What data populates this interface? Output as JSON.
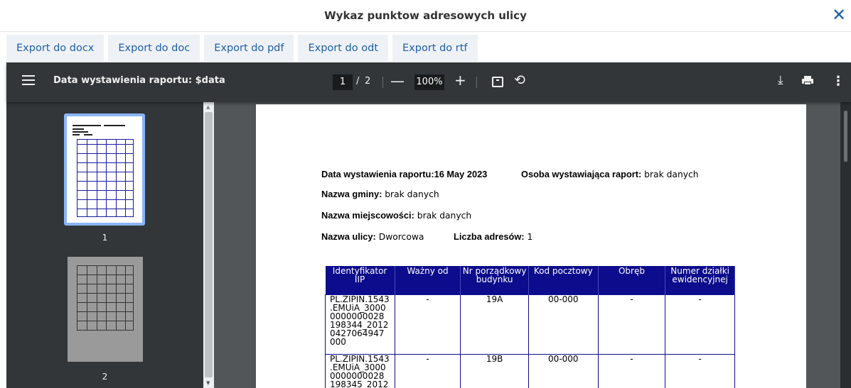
{
  "dialog": {
    "title": "Wykaz punktow adresowych ulicy",
    "close_icon": "close-icon"
  },
  "export_buttons": [
    {
      "label": "Export do docx"
    },
    {
      "label": "Export do doc"
    },
    {
      "label": "Export do pdf"
    },
    {
      "label": "Export do odt"
    },
    {
      "label": "Export do rtf"
    }
  ],
  "pdf_toolbar": {
    "title": "Data wystawienia raportu: $data",
    "current_page": "1",
    "page_separator": "/",
    "total_pages": "2",
    "zoom": "100%",
    "zoom_out_symbol": "—",
    "zoom_in_symbol": "+"
  },
  "thumbnails": [
    {
      "label": "1",
      "selected": true
    },
    {
      "label": "2",
      "selected": false
    }
  ],
  "report": {
    "date_label": "Data wystawienia raportu:",
    "date_value": "16 May 2023",
    "issuer_label": "Osoba wystawiająca raport:",
    "issuer_value": " brak danych",
    "municipality_label": "Nazwa gminy:",
    "municipality_value": " brak danych",
    "locality_label": "Nazwa miejscowości:",
    "locality_value": " brak danych",
    "street_label": "Nazwa ulicy:",
    "street_value": " Dworcowa",
    "address_count_label": "Liczba adresów:",
    "address_count_value": " 1",
    "table": {
      "headers": [
        "Identyfikator IIP",
        "Ważny od",
        "Nr porządkowy budynku",
        "Kod pocztowy",
        "Obręb",
        "Numer działki ewidencyjnej"
      ],
      "rows": [
        {
          "id_lines": [
            "PL.ZIPIN.1543",
            ".EMUiA_3000",
            "0000000028",
            "198344_2012",
            "0427064947",
            "000"
          ],
          "valid_from": "-",
          "building_no": "19A",
          "postal_code": "00-000",
          "precinct": "-",
          "parcel_no": "-"
        },
        {
          "id_lines": [
            "PL.ZIPIN.1543",
            ".EMUiA_3000",
            "0000000028",
            "198345_2012"
          ],
          "valid_from": "-",
          "building_no": "19B",
          "postal_code": "00-000",
          "precinct": "-",
          "parcel_no": "-"
        }
      ]
    }
  },
  "colors": {
    "accent": "#1f5ea8",
    "viewer_toolbar": "#323639",
    "viewer_background": "#525659",
    "table_header": "#0c0c8c",
    "thumbnail_selected": "#8ab4f8"
  }
}
